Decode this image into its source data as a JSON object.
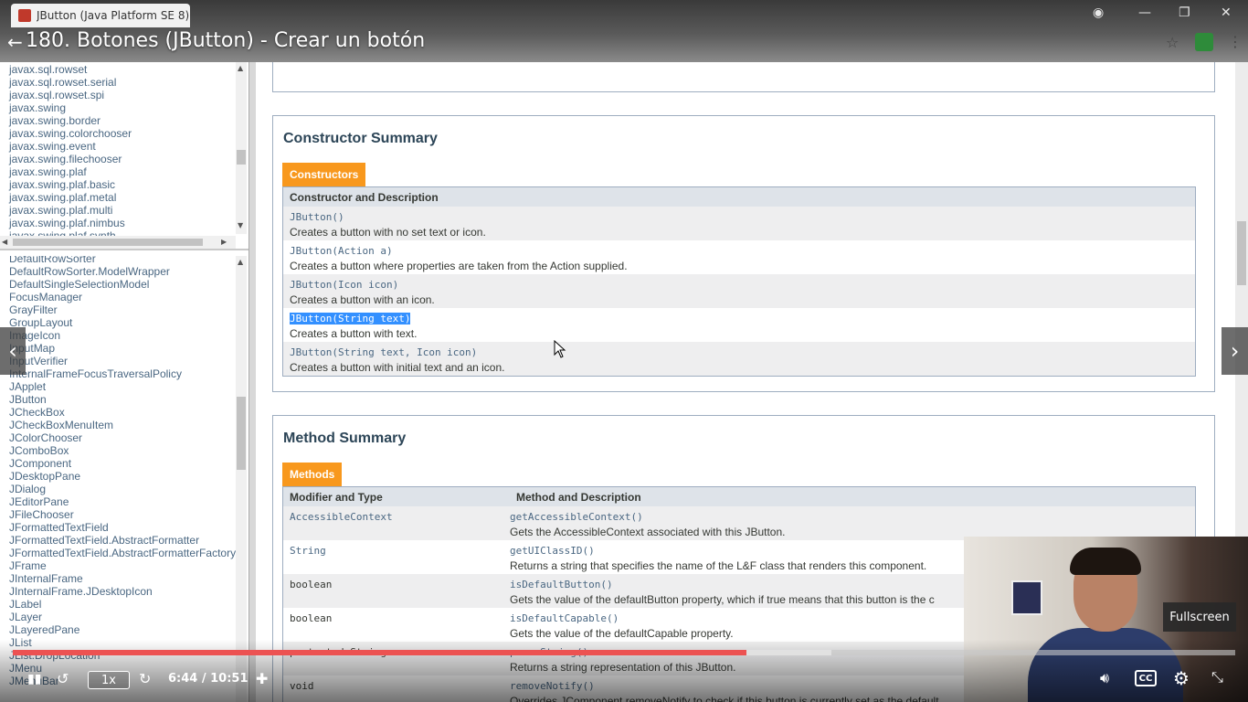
{
  "browser": {
    "tab_title": "JButton (Java Platform SE 8)",
    "video_title": "180. Botones (JButton) - Crear un botón"
  },
  "packages": [
    "javax.sql.rowset",
    "javax.sql.rowset.serial",
    "javax.sql.rowset.spi",
    "javax.swing",
    "javax.swing.border",
    "javax.swing.colorchooser",
    "javax.swing.event",
    "javax.swing.filechooser",
    "javax.swing.plaf",
    "javax.swing.plaf.basic",
    "javax.swing.plaf.metal",
    "javax.swing.plaf.multi",
    "javax.swing.plaf.nimbus",
    "javax.swing.plaf.synth"
  ],
  "classes": [
    "DefaultRowSorter",
    "DefaultRowSorter.ModelWrapper",
    "DefaultSingleSelectionModel",
    "FocusManager",
    "GrayFilter",
    "GroupLayout",
    "ImageIcon",
    "InputMap",
    "InputVerifier",
    "InternalFrameFocusTraversalPolicy",
    "JApplet",
    "JButton",
    "JCheckBox",
    "JCheckBoxMenuItem",
    "JColorChooser",
    "JComboBox",
    "JComponent",
    "JDesktopPane",
    "JDialog",
    "JEditorPane",
    "JFileChooser",
    "JFormattedTextField",
    "JFormattedTextField.AbstractFormatter",
    "JFormattedTextField.AbstractFormatterFactory",
    "JFrame",
    "JInternalFrame",
    "JInternalFrame.JDesktopIcon",
    "JLabel",
    "JLayer",
    "JLayeredPane",
    "JList",
    "JList.DropLocation",
    "JMenu",
    "JMenuBar"
  ],
  "constructor_summary": {
    "heading": "Constructor Summary",
    "caption": "Constructors",
    "column_header": "Constructor and Description",
    "rows": [
      {
        "signature": "JButton()",
        "description": "Creates a button with no set text or icon."
      },
      {
        "signature": "JButton(Action a)",
        "description": "Creates a button where properties are taken from the Action supplied."
      },
      {
        "signature": "JButton(Icon icon)",
        "description": "Creates a button with an icon."
      },
      {
        "signature": "JButton(String text)",
        "description": "Creates a button with text.",
        "selected": true
      },
      {
        "signature": "JButton(String text, Icon icon)",
        "description": "Creates a button with initial text and an icon."
      }
    ]
  },
  "method_summary": {
    "heading": "Method Summary",
    "caption": "Methods",
    "col1_header": "Modifier and Type",
    "col2_header": "Method and Description",
    "rows": [
      {
        "type": "AccessibleContext",
        "method": "getAccessibleContext()",
        "description": "Gets the AccessibleContext associated with this JButton."
      },
      {
        "type": "String",
        "method": "getUIClassID()",
        "description": "Returns a string that specifies the name of the L&F class that renders this component."
      },
      {
        "type": "boolean",
        "method": "isDefaultButton()",
        "description": "Gets the value of the defaultButton property, which if true means that this button is the c"
      },
      {
        "type": "boolean",
        "method": "isDefaultCapable()",
        "description": "Gets the value of the defaultCapable property."
      },
      {
        "type": "protected String",
        "method": "paramString()",
        "description": "Returns a string representation of this JButton."
      },
      {
        "type": "void",
        "method": "removeNotify()",
        "description": "Overrides JComponent.removeNotify to check if this button is currently set as the default"
      }
    ]
  },
  "player": {
    "speed": "1x",
    "time": "6:44 / 10:51",
    "progress_played": 0.6,
    "progress_buffered": 0.67,
    "tooltip": "Fullscreen",
    "colors": {
      "progress": "#ec5252",
      "caption_orange": "#f8981d"
    }
  },
  "icons": [
    "back-arrow-icon",
    "star-icon",
    "menu-icon",
    "chevron-left-icon",
    "chevron-right-icon",
    "rewind-icon",
    "forward-icon",
    "volume-icon",
    "cc-icon",
    "settings-icon",
    "fullscreen-icon"
  ]
}
